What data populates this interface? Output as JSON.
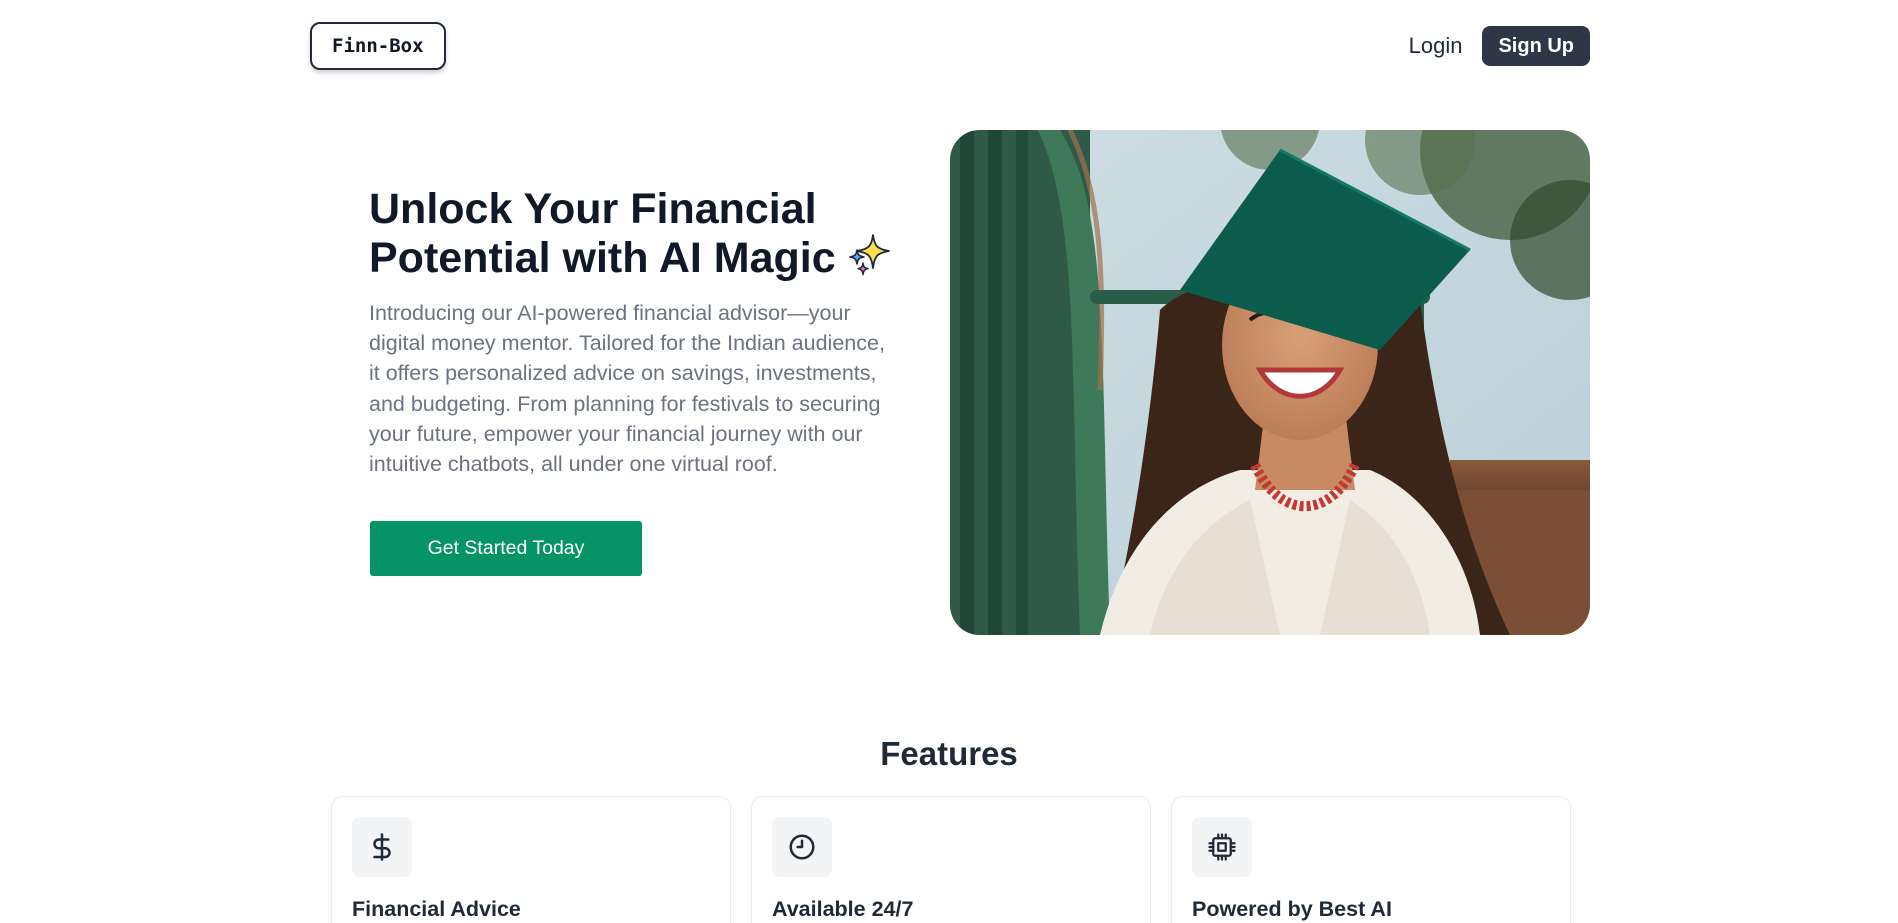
{
  "header": {
    "logo_text": "Finn-Box",
    "login_label": "Login",
    "signup_label": "Sign Up"
  },
  "hero": {
    "title": "Unlock Your Financial Potential with AI Magic",
    "title_emoji": "sparkles-icon",
    "description": "Introducing our AI-powered financial advisor—your digital money mentor. Tailored for the Indian audience, it offers personalized advice on savings, investments, and budgeting. From planning for festivals to securing your future, empower your financial journey with our intuitive chatbots, all under one virtual roof.",
    "cta_label": "Get Started Today",
    "image": "graduate-woman-photo"
  },
  "features": {
    "title": "Features",
    "items": [
      {
        "icon": "dollar-icon",
        "title": "Financial Advice"
      },
      {
        "icon": "clock-icon",
        "title": "Available 24/7"
      },
      {
        "icon": "cpu-chip-icon",
        "title": "Powered by Best AI"
      }
    ]
  },
  "colors": {
    "primary_green": "#069466",
    "dark_button": "#2d3748",
    "heading": "#111827",
    "body_text": "#6b7280"
  }
}
